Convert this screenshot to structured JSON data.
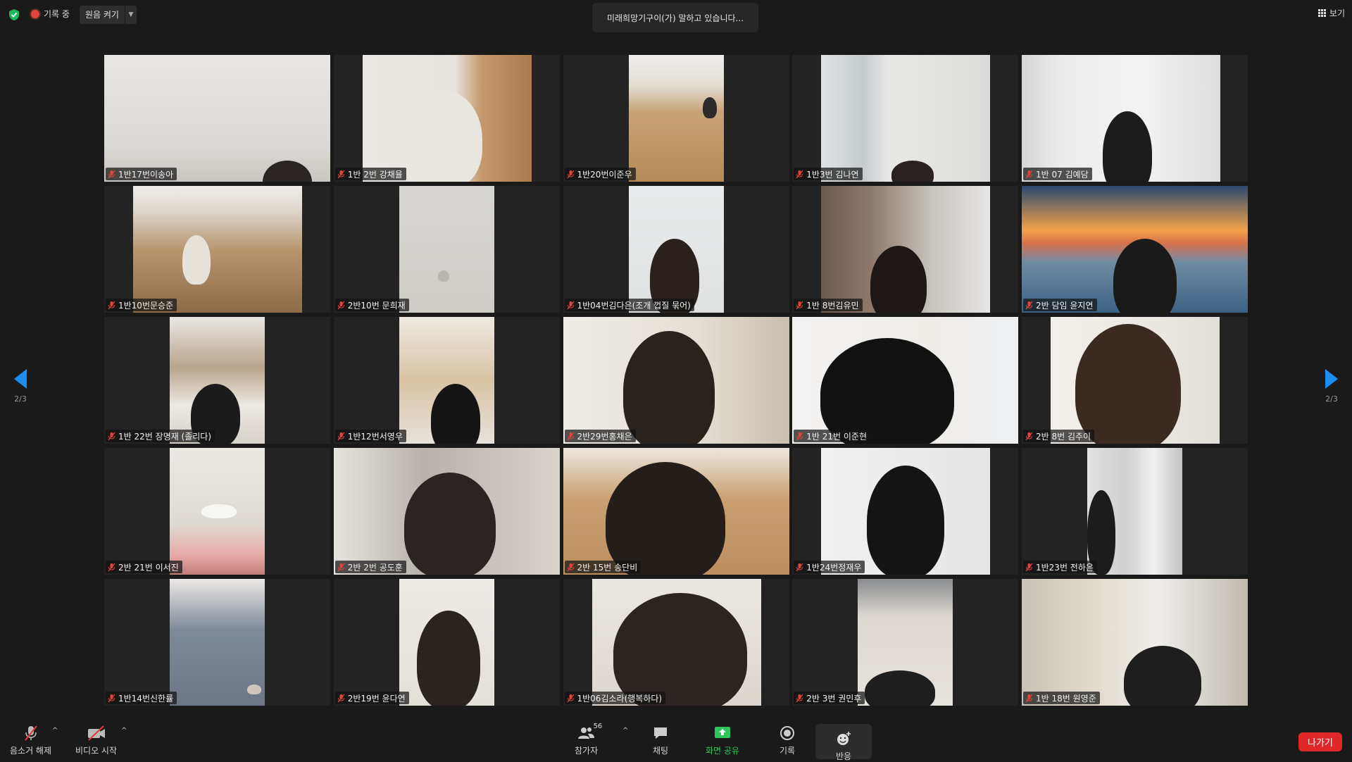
{
  "top": {
    "rec_label": "기록 중",
    "original_sound": "원음 켜기",
    "speaking": "미래희망기구이(가) 말하고 있습니다...",
    "view_label": "보기"
  },
  "pagination": {
    "left": "2/3",
    "right": "2/3"
  },
  "participants": [
    "1반17번이송아",
    "1반 2번 강채율",
    "1반20번이준우",
    "1반3번 김나연",
    "1반 07 김예담",
    "1반10번문승준",
    "2반10번 문희재",
    "1반04번김다은(조개 껍질 묶어)",
    "1반 8번김유민",
    "2반 담임 윤지연",
    "1반 22번 장명재 (졸리다)",
    "1반12번서영우",
    "2반29번홍채은",
    "1반 21번 이준현",
    "2반 8번 김주이",
    "2반 21번 이서진",
    "2반 2번 공도훈",
    "2반 15번 송단비",
    "1반24번정재우",
    "1반23번 전하은",
    "1반14번신한률",
    "2반19번 윤다연",
    "1반06김소라(행복하다)",
    "2반 3번 권민후",
    "1반 18번 원영준"
  ],
  "toolbar": {
    "mute": "음소거 해제",
    "video": "비디오 시작",
    "participants": "참가자",
    "participant_count": "56",
    "chat": "채팅",
    "share": "화면 공유",
    "record": "기록",
    "reactions": "반응",
    "leave": "나가기"
  },
  "colors": {
    "accent": "#1e8ff0",
    "share_green": "#2ec55c",
    "leave_red": "#e02828",
    "muted_red": "#e0443c"
  }
}
